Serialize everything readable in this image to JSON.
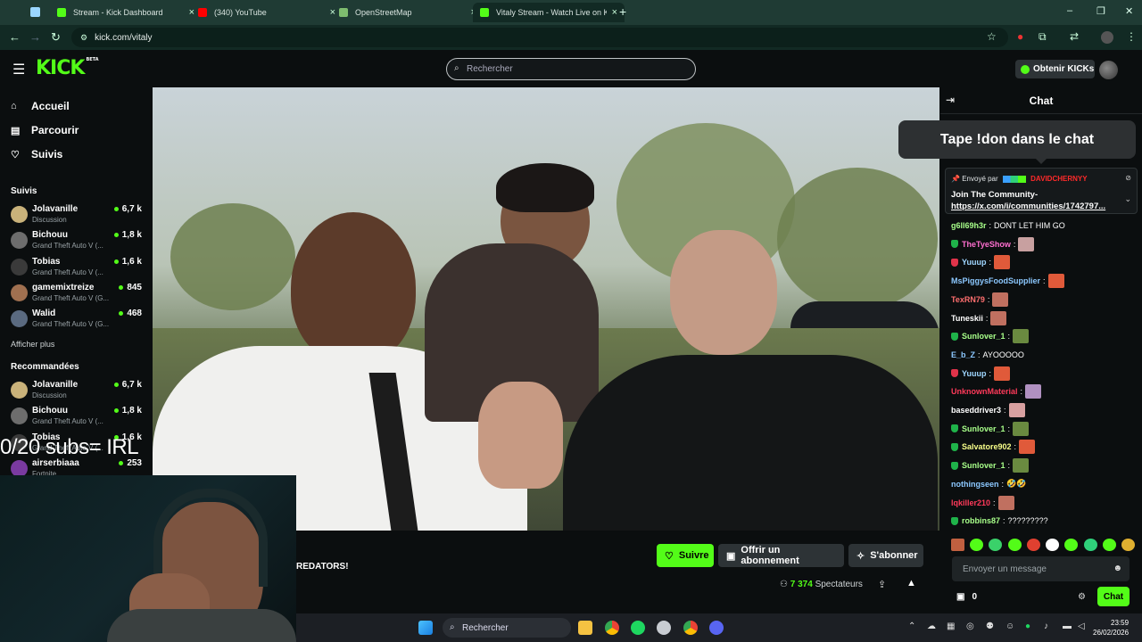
{
  "browser": {
    "tabs": [
      {
        "title": "Stream - Kick Dashboard",
        "favicon_color": "#53fc18"
      },
      {
        "title": "(340) YouTube",
        "favicon_color": "#ff0000"
      },
      {
        "title": "OpenStreetMap",
        "favicon_color": "#7ebc6f"
      },
      {
        "title": "Vitaly Stream - Watch Live on K",
        "favicon_color": "#53fc18"
      }
    ],
    "url": "kick.com/vitaly"
  },
  "header": {
    "logo": "KICK",
    "logo_tag": "BETA",
    "search_placeholder": "Rechercher",
    "get_kicks": "Obtenir KICKs"
  },
  "sidebar": {
    "nav": [
      {
        "label": "Accueil",
        "icon": "home-icon"
      },
      {
        "label": "Parcourir",
        "icon": "browse-icon"
      },
      {
        "label": "Suivis",
        "icon": "heart-icon"
      }
    ],
    "followed_title": "Suivis",
    "followed": [
      {
        "name": "Jolavanille",
        "category": "Discussion",
        "viewers": "6,7 k",
        "color": "#c9b27a"
      },
      {
        "name": "Bichouu",
        "category": "Grand Theft Auto V (...",
        "viewers": "1,8 k",
        "color": "#6d6d6d"
      },
      {
        "name": "Tobias",
        "category": "Grand Theft Auto V (...",
        "viewers": "1,6 k",
        "color": "#3a3a3a"
      },
      {
        "name": "gamemixtreize",
        "category": "Grand Theft Auto V (G...",
        "viewers": "845",
        "color": "#a07050"
      },
      {
        "name": "Walid",
        "category": "Grand Theft Auto V (G...",
        "viewers": "468",
        "color": "#5a6a80"
      }
    ],
    "show_more": "Afficher plus",
    "recommended_title": "Recommandées",
    "recommended": [
      {
        "name": "Jolavanille",
        "category": "Discussion",
        "viewers": "6,7 k",
        "color": "#c9b27a"
      },
      {
        "name": "Bichouu",
        "category": "Grand Theft Auto V (...",
        "viewers": "1,8 k",
        "color": "#6d6d6d"
      },
      {
        "name": "Tobias",
        "category": "Grand Theft Auto V (...",
        "viewers": "1,6 k",
        "color": "#3a3a3a"
      },
      {
        "name": "airserbiaaa",
        "category": "Fortnite",
        "viewers": "253",
        "color": "#7a3aa0"
      }
    ]
  },
  "stream": {
    "title_fragment": "REDATORS!",
    "follow_label": "Suivre",
    "gift_label": "Offrir un abonnement",
    "subscribe_label": "S'abonner",
    "viewers": "7 374",
    "viewers_label": "Spectateurs"
  },
  "overlay": {
    "toast": "Tape !don dans le chat",
    "subs_text": "0/20 subs= IRL"
  },
  "chat": {
    "title": "Chat",
    "pinned": {
      "sent_by_label": "Envoyé par",
      "sender": "DAVIDCHERNYY",
      "message_line1": "Join The Community-",
      "message_link": "https://x.com/i/communities/1742797..."
    },
    "messages": [
      {
        "user": "g6ll69h3r",
        "color": "#a8ff8a",
        "text": "DONT LET HIM GO",
        "badge": "",
        "emote": ""
      },
      {
        "user": "TheTyeShow",
        "color": "#ff6fd0",
        "text": "",
        "badge": "#1fb34a",
        "emote": "#c8a0a0"
      },
      {
        "user": "Yuuup",
        "color": "#9fd6ff",
        "text": "",
        "badge": "#e0334a",
        "emote": "#e05a3a"
      },
      {
        "user": "MsPiggysFoodSupplier",
        "color": "#8cc8ff",
        "text": "",
        "badge": "",
        "emote": "#e05a3a"
      },
      {
        "user": "TexRN79",
        "color": "#ff6f6f",
        "text": "",
        "badge": "",
        "emote": "#c07060"
      },
      {
        "user": "Tuneskii",
        "color": "#ffffff",
        "text": "",
        "badge": "",
        "emote": "#c07060"
      },
      {
        "user": "Sunlover_1",
        "color": "#a8ff8a",
        "text": "",
        "badge": "#1fb34a",
        "emote": "#6a8a40"
      },
      {
        "user": "E_b_Z",
        "color": "#8cc8ff",
        "text": "AYOOOOO",
        "badge": "",
        "emote": ""
      },
      {
        "user": "Yuuup",
        "color": "#9fd6ff",
        "text": "",
        "badge": "#e0334a",
        "emote": "#e05a3a"
      },
      {
        "user": "UnknownMaterial",
        "color": "#ff3a5a",
        "text": "",
        "badge": "",
        "emote": "#b090c0"
      },
      {
        "user": "baseddriver3",
        "color": "#ffffff",
        "text": "",
        "badge": "",
        "emote": "#d8a0a0"
      },
      {
        "user": "Sunlover_1",
        "color": "#a8ff8a",
        "text": "",
        "badge": "#1fb34a",
        "emote": "#6a8a40"
      },
      {
        "user": "Salvatore902",
        "color": "#f8ff8a",
        "text": "",
        "badge": "#1fb34a",
        "emote": "#e05a3a"
      },
      {
        "user": "Sunlover_1",
        "color": "#a8ff8a",
        "text": "",
        "badge": "#1fb34a",
        "emote": "#6a8a40"
      },
      {
        "user": "nothingseen",
        "color": "#8cc8ff",
        "text": "🤣🤣",
        "badge": "",
        "emote": ""
      },
      {
        "user": "lqkiller210",
        "color": "#ff3a5a",
        "text": "",
        "badge": "",
        "emote": "#c07060"
      },
      {
        "user": "robbins87",
        "color": "#a8ff8a",
        "text": "?????????",
        "badge": "#1fb34a",
        "emote": ""
      }
    ],
    "input_placeholder": "Envoyer un message",
    "points": "0",
    "send_label": "Chat"
  },
  "taskbar": {
    "search_label": "Rechercher",
    "time": "23:59",
    "date": "26/02/2026"
  }
}
